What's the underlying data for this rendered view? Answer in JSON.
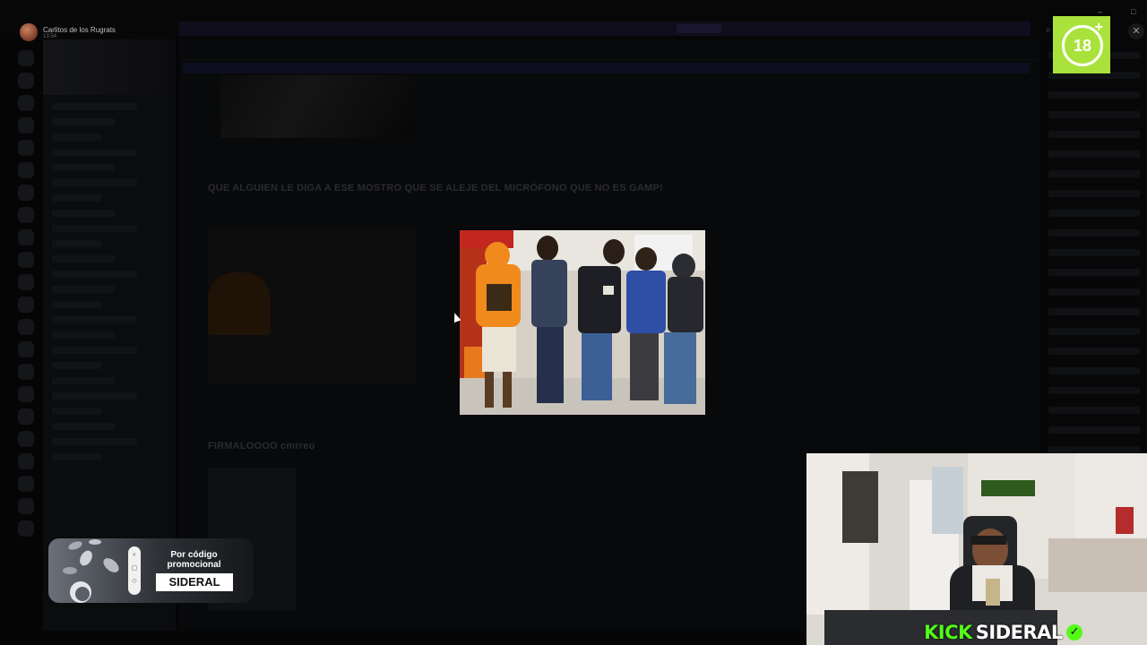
{
  "window": {
    "user_name": "Carlitos de los Rugrats",
    "user_time": "13:54",
    "close_label": "✕",
    "minimize_label": "–",
    "maximize_label": "□"
  },
  "age_badge": {
    "label": "18",
    "plus": "+"
  },
  "chat": {
    "message_1": "QUE ALGUIEN LE DIGA A ESE MOSTRO QUE SE ALEJE DEL MICRÓFONO QUE NO ES GAMP!",
    "message_2": "FIRMALOOOO cmrreo"
  },
  "promo": {
    "text": "Por código promocional",
    "code": "SIDERAL"
  },
  "stream_label": {
    "kick": "KICK",
    "name": "SIDERAL",
    "check": "✓"
  },
  "colors": {
    "kick_green": "#53fc18",
    "badge_green": "#a9e23b",
    "orange_hoodie": "#f08a1c"
  }
}
